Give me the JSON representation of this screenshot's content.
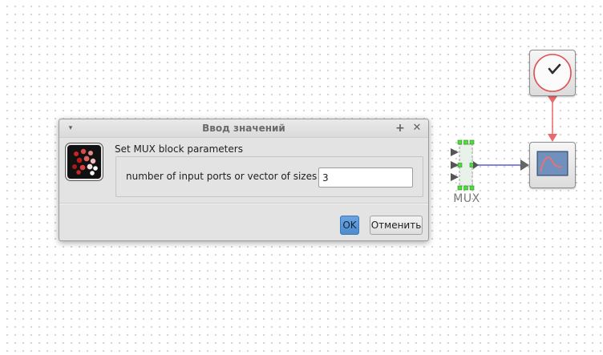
{
  "canvas": {
    "blocks": [
      {
        "name": "clock",
        "icon": "clock-icon"
      },
      {
        "name": "scope",
        "icon": "scope-plot-icon"
      },
      {
        "name": "mux",
        "label": "MUX"
      }
    ]
  },
  "dialog": {
    "title": "Ввод значений",
    "icon": "scilab-icon",
    "header": "Set MUX block parameters",
    "field_label": "number of input ports or vector of sizes",
    "field_value": "3",
    "ok_label": "OK",
    "cancel_label": "Отменить",
    "menu_icon": "▾",
    "pin_icon": "+",
    "close_icon": "✕"
  },
  "colors": {
    "event_link": "#e86a6a",
    "data_link": "#5c5cd6",
    "port_green": "#4fdc3c",
    "ok_button": "#5a96d6"
  }
}
